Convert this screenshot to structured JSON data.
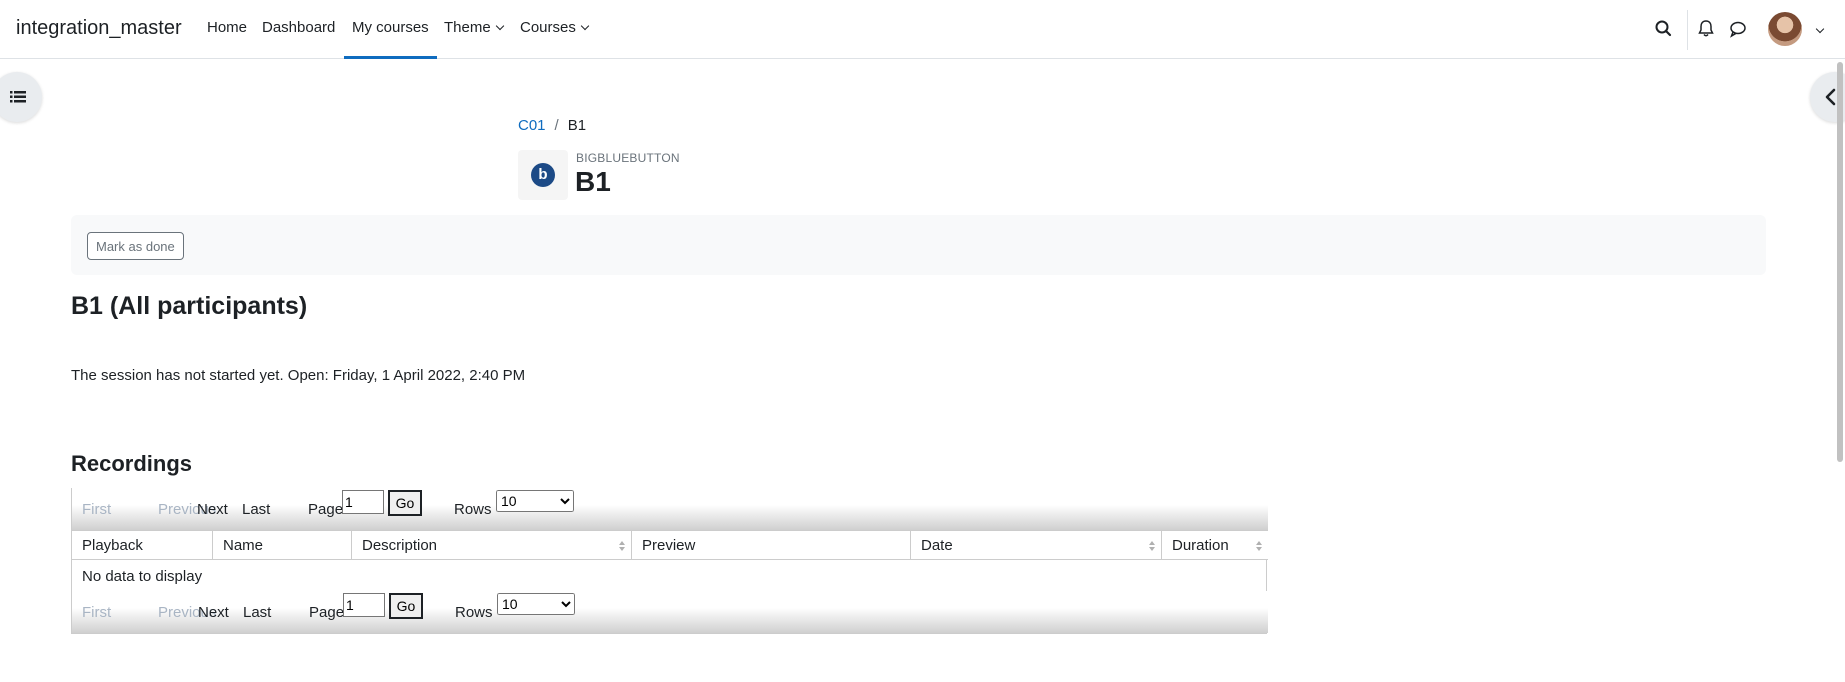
{
  "navbar": {
    "site_name": "integration_master",
    "items": [
      {
        "label": "Home"
      },
      {
        "label": "Dashboard"
      },
      {
        "label": "My courses"
      },
      {
        "label": "Theme"
      },
      {
        "label": "Courses"
      }
    ],
    "active_item": "My courses",
    "accent_color": "#0f6cbf"
  },
  "header": {
    "breadcrumb": [
      "C01",
      "B1"
    ],
    "activity_type": "BIGBLUEBUTTON",
    "activity_icon_letter": "b",
    "title": "B1"
  },
  "completion": {
    "button_label": "Mark as done"
  },
  "main": {
    "heading": "B1 (All participants)",
    "session_text": "The session has not started yet. Open: Friday, 1 April 2022, 2:40 PM",
    "recordings_heading": "Recordings"
  },
  "recordings": {
    "pager": {
      "first": "First",
      "previous": "Previous",
      "next": "Next",
      "last": "Last",
      "page_label": "Page",
      "page_value": "1",
      "go_label": "Go",
      "rows_label": "Rows",
      "rows_value": "10"
    },
    "columns": [
      "Playback",
      "Name",
      "Description",
      "Preview",
      "Date",
      "Duration"
    ],
    "empty_message": "No data to display"
  }
}
